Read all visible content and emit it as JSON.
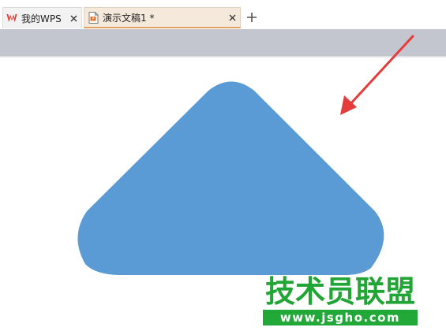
{
  "tabs": [
    {
      "label": "我的WPS",
      "icon": "wps-logo-icon",
      "active": false
    },
    {
      "label": "演示文稿1 *",
      "icon": "presentation-file-icon",
      "active": true
    }
  ],
  "new_tab_icon": "plus-icon",
  "close_icon": "close-icon",
  "slide": {
    "shape": "rounded-triangle",
    "shape_color": "#5b9bd5",
    "arrow_color": "#e63b3b"
  },
  "watermark": {
    "title": "技术员联盟",
    "url": "www.jsgho.com",
    "color": "#21a535"
  }
}
